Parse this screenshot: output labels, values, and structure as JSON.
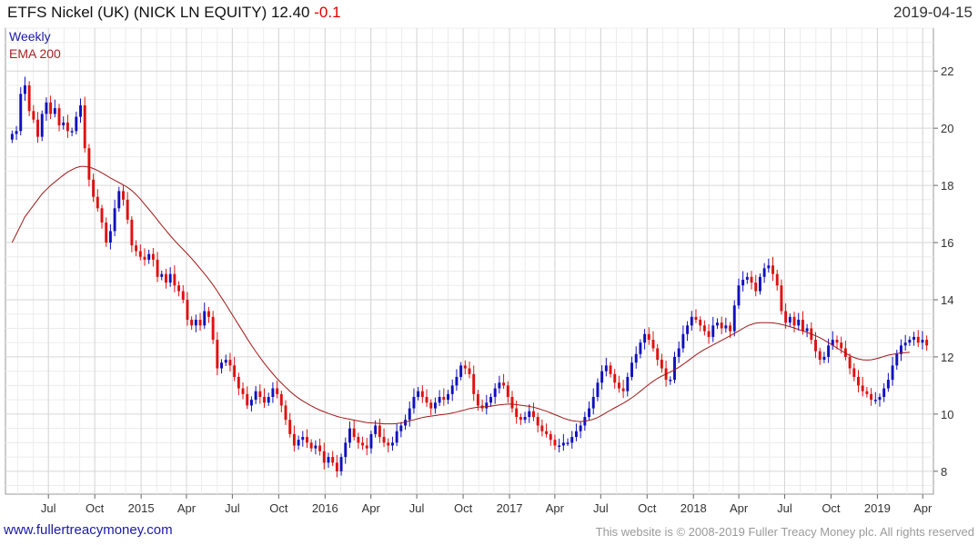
{
  "header": {
    "title": "ETFS Nickel (UK) (NICK LN EQUITY) 12.40",
    "change": "-0.1",
    "date": "2019-04-15"
  },
  "legend": {
    "weekly": "Weekly",
    "ema": "EMA 200"
  },
  "footer": {
    "link": "www.fullertreacymoney.com",
    "copyright": "This website is © 2008-2019 Fuller Treacy Money plc. All rights reserved"
  },
  "colors": {
    "up": "#1010c0",
    "down": "#e01010",
    "ema": "#a01818",
    "grid": "#d6d6d6"
  },
  "chart_data": {
    "type": "candlestick",
    "interval": "weekly",
    "ylim": [
      7.2,
      23.5
    ],
    "yticks": [
      8,
      10,
      12,
      14,
      16,
      18,
      20,
      22
    ],
    "x_start": "2014-04-14",
    "x_end": "2019-04-15",
    "xticks": [
      {
        "label": "Jul",
        "date": "2014-07-01"
      },
      {
        "label": "Oct",
        "date": "2014-10-01"
      },
      {
        "label": "2015",
        "date": "2015-01-01"
      },
      {
        "label": "Apr",
        "date": "2015-04-01"
      },
      {
        "label": "Jul",
        "date": "2015-07-01"
      },
      {
        "label": "Oct",
        "date": "2015-10-01"
      },
      {
        "label": "2016",
        "date": "2016-01-01"
      },
      {
        "label": "Apr",
        "date": "2016-04-01"
      },
      {
        "label": "Jul",
        "date": "2016-07-01"
      },
      {
        "label": "Oct",
        "date": "2016-10-01"
      },
      {
        "label": "2017",
        "date": "2017-01-01"
      },
      {
        "label": "Apr",
        "date": "2017-04-01"
      },
      {
        "label": "Jul",
        "date": "2017-07-01"
      },
      {
        "label": "Oct",
        "date": "2017-10-01"
      },
      {
        "label": "2018",
        "date": "2018-01-01"
      },
      {
        "label": "Apr",
        "date": "2018-04-01"
      },
      {
        "label": "Jul",
        "date": "2018-07-01"
      },
      {
        "label": "Oct",
        "date": "2018-10-01"
      },
      {
        "label": "2019",
        "date": "2019-01-01"
      },
      {
        "label": "Apr",
        "date": "2019-04-01"
      }
    ],
    "closes": [
      19.8,
      19.9,
      21.2,
      21.5,
      20.6,
      20.3,
      19.7,
      20.5,
      20.9,
      20.5,
      20.7,
      20.1,
      20.2,
      19.9,
      19.9,
      20.4,
      20.8,
      19.3,
      18.2,
      17.6,
      17.2,
      16.7,
      16.0,
      16.4,
      17.2,
      17.8,
      17.5,
      16.8,
      15.9,
      15.7,
      15.5,
      15.4,
      15.6,
      15.4,
      14.8,
      14.9,
      14.6,
      14.9,
      14.5,
      14.3,
      14.0,
      13.3,
      13.1,
      13.3,
      13.1,
      13.6,
      13.4,
      12.6,
      11.6,
      11.8,
      11.9,
      11.7,
      11.3,
      10.9,
      10.7,
      10.3,
      10.5,
      10.8,
      10.6,
      10.4,
      10.6,
      10.9,
      10.7,
      10.3,
      9.8,
      9.3,
      8.9,
      9.1,
      9.2,
      9.0,
      8.8,
      8.9,
      8.7,
      8.3,
      8.5,
      8.3,
      8.0,
      8.5,
      9.0,
      9.5,
      9.2,
      9.0,
      8.9,
      8.8,
      9.3,
      9.6,
      9.2,
      9.0,
      8.9,
      9.0,
      9.4,
      9.6,
      9.8,
      10.2,
      10.6,
      10.8,
      10.6,
      10.4,
      10.2,
      10.4,
      10.6,
      10.5,
      10.7,
      11.0,
      11.3,
      11.7,
      11.6,
      11.4,
      10.7,
      10.3,
      10.2,
      10.4,
      10.6,
      10.9,
      11.1,
      11.0,
      10.6,
      10.2,
      9.9,
      9.8,
      9.9,
      10.1,
      9.9,
      9.6,
      9.4,
      9.3,
      9.1,
      8.9,
      8.9,
      9.0,
      9.0,
      9.2,
      9.4,
      9.6,
      9.9,
      10.2,
      10.6,
      11.1,
      11.5,
      11.7,
      11.4,
      11.1,
      10.9,
      10.8,
      11.3,
      11.8,
      12.1,
      12.5,
      12.8,
      12.6,
      12.3,
      11.9,
      11.6,
      11.2,
      11.2,
      12.0,
      12.3,
      12.8,
      13.1,
      13.4,
      13.3,
      13.1,
      12.9,
      12.7,
      13.1,
      13.2,
      13.0,
      13.1,
      12.9,
      13.8,
      14.5,
      14.7,
      14.8,
      14.6,
      14.3,
      14.8,
      15.1,
      15.2,
      14.9,
      14.5,
      13.6,
      13.2,
      13.4,
      13.1,
      13.3,
      12.9,
      13.0,
      12.6,
      12.2,
      11.9,
      12.0,
      12.4,
      12.6,
      12.5,
      12.3,
      12.0,
      11.6,
      11.3,
      11.0,
      10.8,
      10.7,
      10.5,
      10.5,
      10.6,
      10.9,
      11.2,
      11.7,
      12.1,
      12.4,
      12.5,
      12.6,
      12.7,
      12.5,
      12.6,
      12.4
    ],
    "ema200": [
      16.0,
      16.3,
      16.6,
      16.9,
      17.1,
      17.3,
      17.5,
      17.7,
      17.85,
      18.0,
      18.12,
      18.24,
      18.36,
      18.47,
      18.55,
      18.62,
      18.66,
      18.66,
      18.64,
      18.59,
      18.52,
      18.44,
      18.35,
      18.26,
      18.18,
      18.1,
      18.02,
      17.93,
      17.82,
      17.68,
      17.52,
      17.34,
      17.16,
      16.98,
      16.79,
      16.6,
      16.42,
      16.24,
      16.07,
      15.91,
      15.76,
      15.6,
      15.44,
      15.27,
      15.09,
      14.91,
      14.72,
      14.52,
      14.3,
      14.07,
      13.84,
      13.6,
      13.36,
      13.12,
      12.88,
      12.64,
      12.41,
      12.19,
      11.98,
      11.78,
      11.59,
      11.41,
      11.24,
      11.09,
      10.94,
      10.8,
      10.67,
      10.56,
      10.46,
      10.37,
      10.29,
      10.21,
      10.14,
      10.08,
      10.02,
      9.97,
      9.92,
      9.88,
      9.85,
      9.82,
      9.79,
      9.76,
      9.73,
      9.7,
      9.69,
      9.68,
      9.67,
      9.66,
      9.66,
      9.66,
      9.67,
      9.69,
      9.72,
      9.76,
      9.8,
      9.84,
      9.88,
      9.91,
      9.93,
      9.95,
      9.97,
      9.99,
      10.01,
      10.04,
      10.07,
      10.11,
      10.15,
      10.19,
      10.22,
      10.24,
      10.25,
      10.26,
      10.28,
      10.3,
      10.32,
      10.34,
      10.35,
      10.35,
      10.33,
      10.31,
      10.29,
      10.27,
      10.24,
      10.2,
      10.15,
      10.1,
      10.04,
      9.98,
      9.92,
      9.86,
      9.81,
      9.77,
      9.75,
      9.74,
      9.75,
      9.78,
      9.82,
      9.88,
      9.96,
      10.05,
      10.14,
      10.22,
      10.3,
      10.38,
      10.47,
      10.57,
      10.68,
      10.8,
      10.92,
      11.04,
      11.15,
      11.25,
      11.33,
      11.4,
      11.47,
      11.55,
      11.64,
      11.74,
      11.85,
      11.96,
      12.07,
      12.17,
      12.26,
      12.34,
      12.42,
      12.5,
      12.58,
      12.66,
      12.74,
      12.82,
      12.91,
      13.0,
      13.08,
      13.14,
      13.18,
      13.2,
      13.2,
      13.2,
      13.19,
      13.17,
      13.14,
      13.1,
      13.06,
      13.01,
      12.96,
      12.91,
      12.86,
      12.8,
      12.74,
      12.67,
      12.59,
      12.5,
      12.41,
      12.31,
      12.22,
      12.13,
      12.05,
      11.98,
      11.93,
      11.9,
      11.89,
      11.9,
      11.93,
      11.97,
      12.02,
      12.06,
      12.09,
      12.12,
      12.14,
      12.15,
      12.16
    ]
  }
}
